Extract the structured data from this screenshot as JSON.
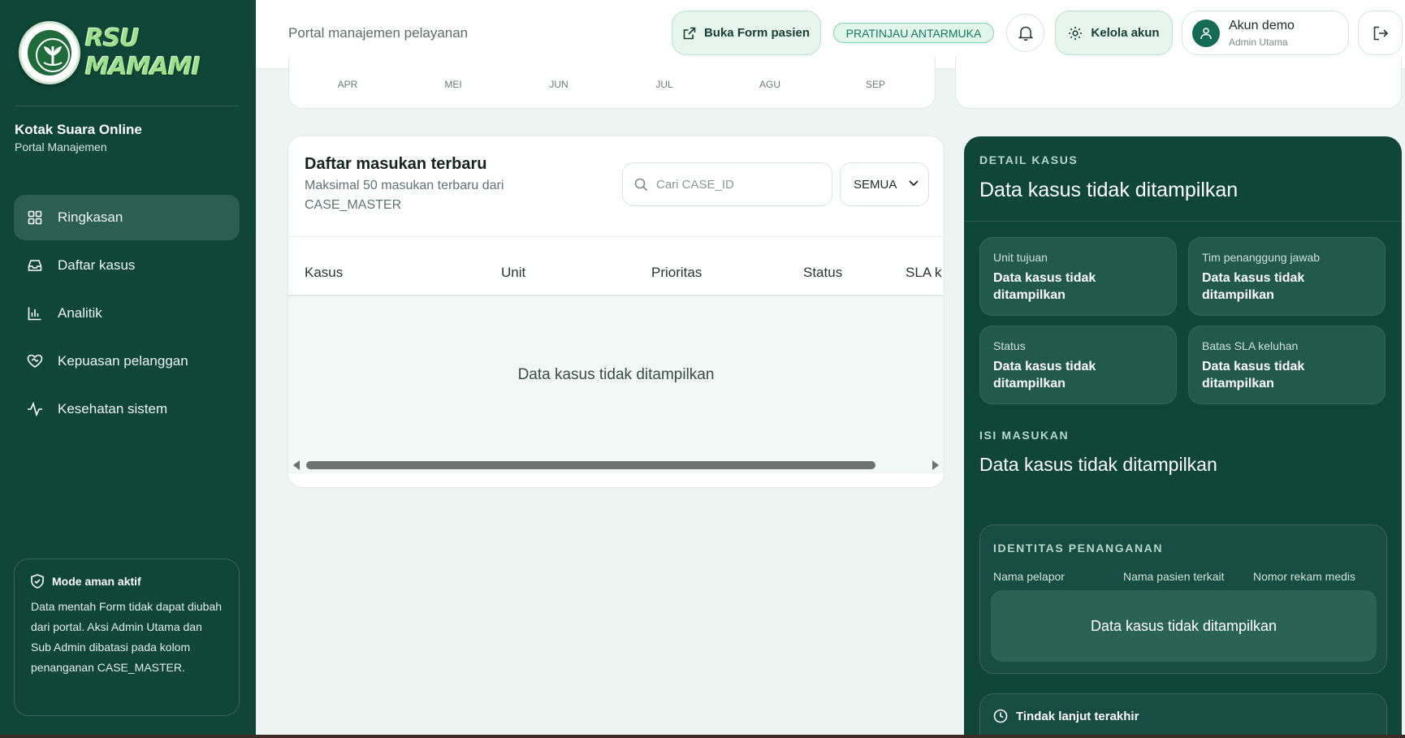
{
  "sidebar": {
    "logo_text": "RSU MAMAMI",
    "brand_title": "Kotak Suara Online",
    "brand_subtitle": "Portal Manajemen",
    "items": [
      {
        "label": "Ringkasan",
        "icon": "grid-icon",
        "active": true
      },
      {
        "label": "Daftar kasus",
        "icon": "inbox-icon",
        "active": false
      },
      {
        "label": "Analitik",
        "icon": "bar-chart-icon",
        "active": false
      },
      {
        "label": "Kepuasan pelanggan",
        "icon": "heart-handshake-icon",
        "active": false
      },
      {
        "label": "Kesehatan sistem",
        "icon": "activity-icon",
        "active": false
      }
    ],
    "safe_mode": {
      "title": "Mode aman aktif",
      "text": "Data mentah Form tidak dapat diubah dari portal. Aksi Admin Utama dan Sub Admin dibatasi pada kolom penanganan CASE_MASTER."
    }
  },
  "header": {
    "title": "Portal manajemen pelayanan",
    "open_form_label": "Buka Form pasien",
    "preview_badge": "PRATINJAU ANTARMUKA",
    "manage_account_label": "Kelola akun",
    "user_name": "Akun demo",
    "user_role": "Admin Utama"
  },
  "chart_data": {
    "type": "line",
    "categories": [
      "APR",
      "MEI",
      "JUN",
      "JUL",
      "AGU",
      "SEP"
    ]
  },
  "list": {
    "title": "Daftar masukan terbaru",
    "subtitle": "Maksimal 50 masukan terbaru dari CASE_MASTER",
    "search_placeholder": "Cari CASE_ID",
    "filter_value": "SEMUA",
    "columns": [
      "Kasus",
      "Unit",
      "Prioritas",
      "Status",
      "SLA k"
    ],
    "empty_message": "Data kasus tidak ditampilkan"
  },
  "detail": {
    "kicker": "DETAIL KASUS",
    "title": "Data kasus tidak ditampilkan",
    "fields": [
      {
        "label": "Unit tujuan",
        "value": "Data kasus tidak ditampilkan"
      },
      {
        "label": "Tim penanggung jawab",
        "value": "Data kasus tidak ditampilkan"
      },
      {
        "label": "Status",
        "value": "Data kasus tidak ditampilkan"
      },
      {
        "label": "Batas SLA keluhan",
        "value": "Data kasus tidak ditampilkan"
      }
    ],
    "isi_kicker": "ISI MASUKAN",
    "isi_value": "Data kasus tidak ditampilkan",
    "ident": {
      "kicker": "IDENTITAS PENANGANAN",
      "columns": [
        "Nama pelapor",
        "Nama pasien terkait",
        "Nomor rekam medis"
      ],
      "empty_message": "Data kasus tidak ditampilkan"
    },
    "tindak_title": "Tindak lanjut terakhir"
  },
  "colors": {
    "sidebar_bg": "#0f4637",
    "accent": "#0d7a5a",
    "accent_soft": "#e6f6ef"
  }
}
